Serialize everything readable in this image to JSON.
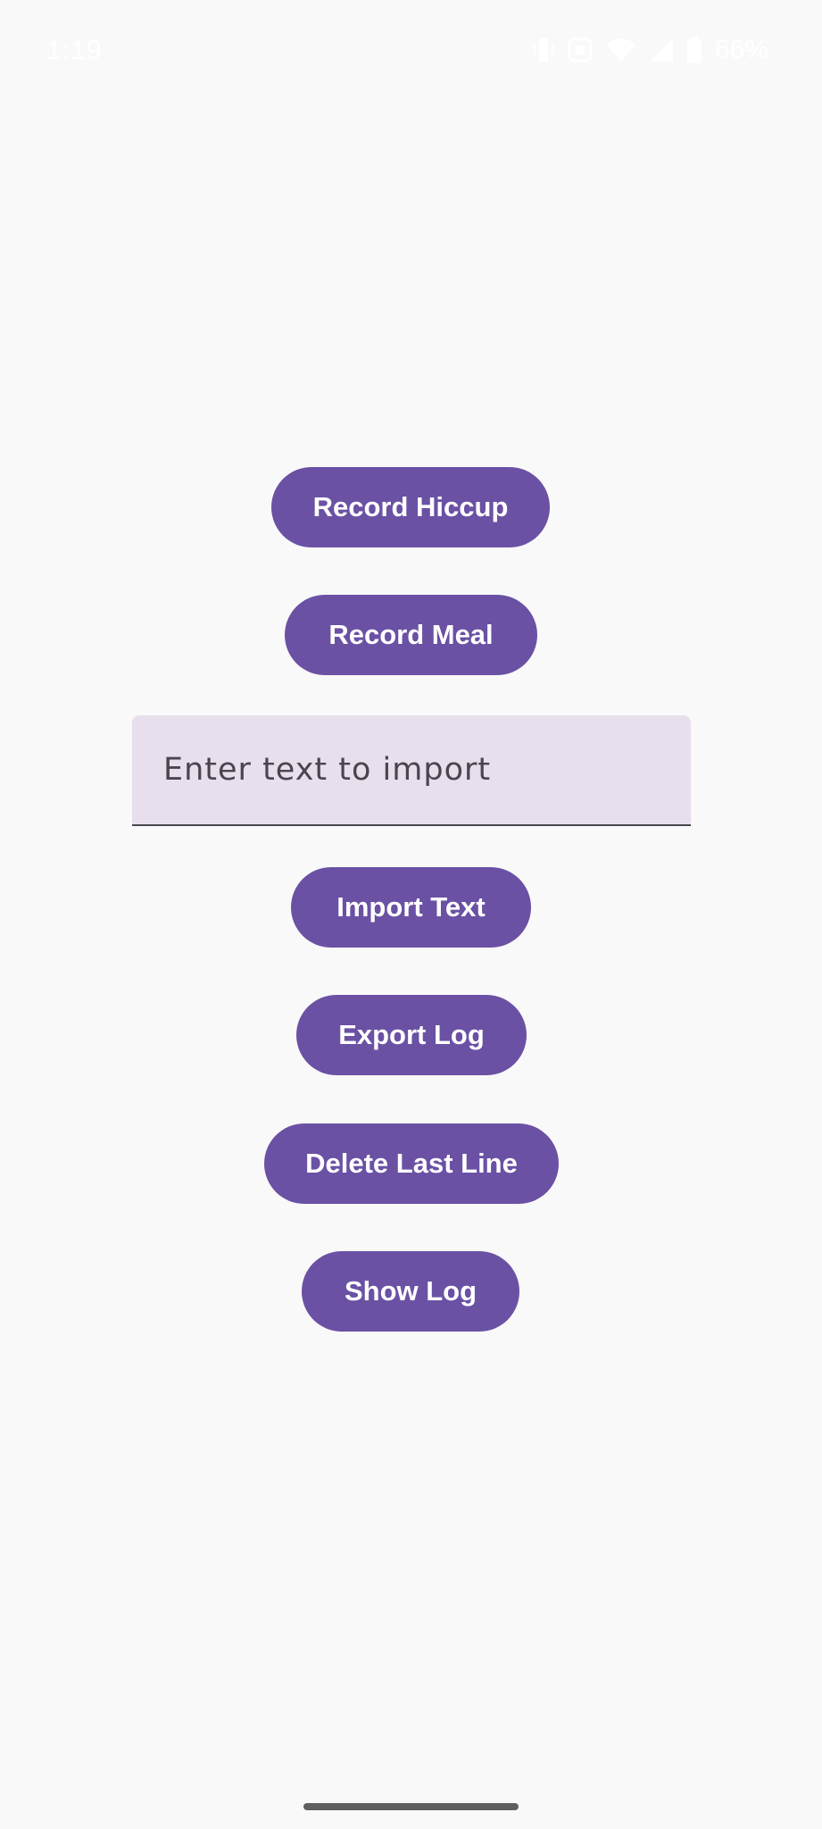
{
  "status_bar": {
    "time": "1:19",
    "battery_percent": "66%",
    "icons": [
      "vibrate-icon",
      "screenshot-icon",
      "wifi-icon",
      "signal-icon",
      "battery-icon"
    ]
  },
  "buttons": {
    "record_hiccup": "Record Hiccup",
    "record_meal": "Record Meal",
    "import_text": "Import Text",
    "export_log": "Export Log",
    "delete_last_line": "Delete Last Line",
    "show_log": "Show Log"
  },
  "import_field": {
    "placeholder": "Enter text to import",
    "value": ""
  },
  "colors": {
    "primary": "#6a51a4",
    "field_background": "#e7dfec",
    "background": "#f9f9f9"
  }
}
